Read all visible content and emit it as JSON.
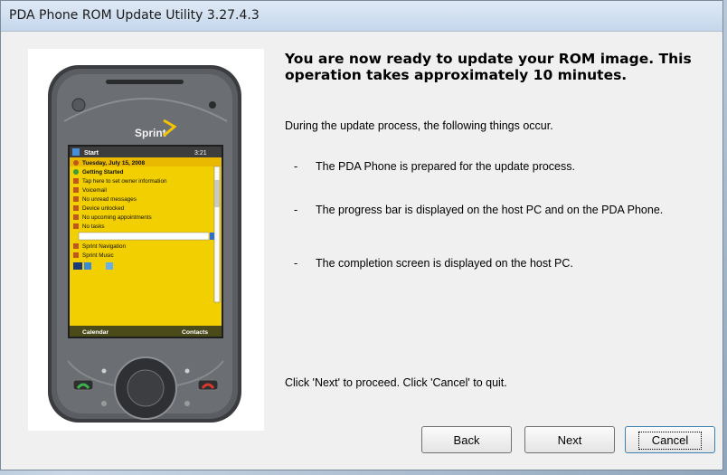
{
  "window": {
    "title": "PDA Phone ROM Update Utility 3.27.4.3"
  },
  "phone": {
    "brand": "Sprint",
    "status_bar": {
      "start": "Start",
      "time": "3:21"
    },
    "date": "Tuesday, July 15, 2008",
    "items": [
      "Getting Started",
      "Tap here to set owner information",
      "Voicemail",
      "No unread messages",
      "Device unlocked",
      "No upcoming appointments",
      "No tasks",
      "Sprint Navigation",
      "Sprint Music"
    ],
    "softkeys": {
      "left": "Calendar",
      "right": "Contacts"
    }
  },
  "content": {
    "headline": "You are now ready to update your ROM image. This operation takes approximately 10 minutes.",
    "intro": "During the update process, the following things occur.",
    "bullets": [
      "The PDA Phone is prepared for the update process.",
      "The progress bar is displayed on the host PC and on the PDA Phone.",
      "The completion screen is displayed on the host PC."
    ],
    "dash": "-",
    "instruction": "Click 'Next' to proceed. Click 'Cancel' to quit."
  },
  "buttons": {
    "back": "Back",
    "next": "Next",
    "cancel": "Cancel"
  }
}
